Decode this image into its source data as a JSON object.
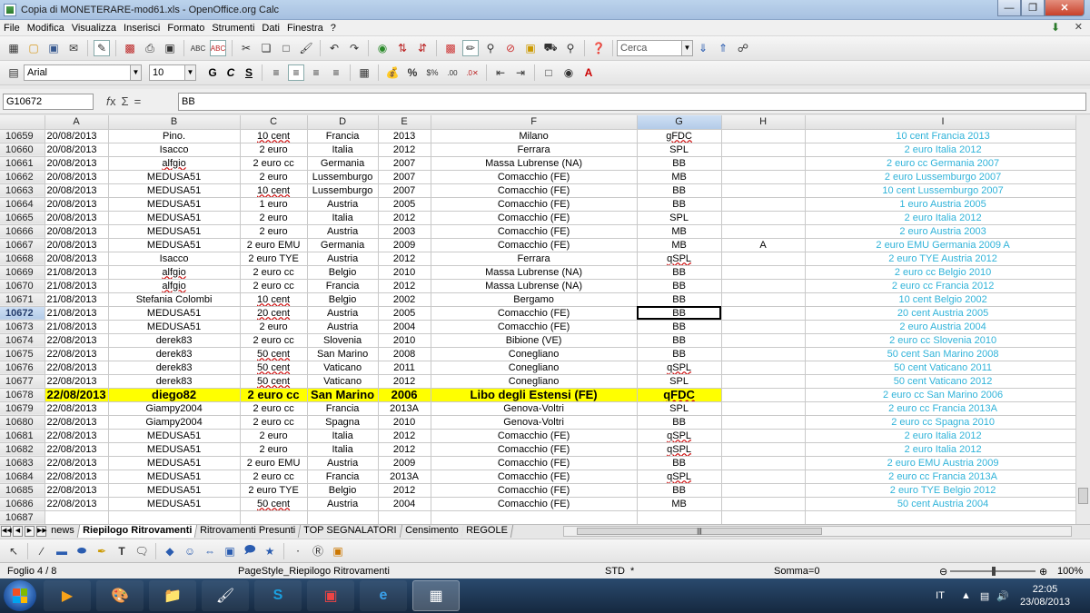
{
  "window": {
    "title": "Copia di MONETERARE-mod61.xls - OpenOffice.org Calc"
  },
  "menu": [
    "File",
    "Modifica",
    "Visualizza",
    "Inserisci",
    "Formato",
    "Strumenti",
    "Dati",
    "Finestra",
    "?"
  ],
  "toolbar": {
    "search_placeholder": "Cerca"
  },
  "format": {
    "font": "Arial",
    "size": "10",
    "bold": "G",
    "italic": "C",
    "underline": "S"
  },
  "formula": {
    "cell_ref": "G10672",
    "content": "BB"
  },
  "columns": [
    "A",
    "B",
    "C",
    "D",
    "E",
    "F",
    "G",
    "H",
    "I"
  ],
  "selected_column": "G",
  "selected_row": "10672",
  "highlight_row": "10678",
  "rows": [
    {
      "n": "10659",
      "a": "20/08/2013",
      "b": "Pino.",
      "c": "10 cent",
      "d": "Francia",
      "e": "2013",
      "f": "Milano",
      "g": "gFDC",
      "h": "",
      "i": "10 cent Francia 2013"
    },
    {
      "n": "10660",
      "a": "20/08/2013",
      "b": "Isacco",
      "c": "2 euro",
      "d": "Italia",
      "e": "2012",
      "f": "Ferrara",
      "g": "SPL",
      "h": "",
      "i": "2 euro Italia 2012"
    },
    {
      "n": "10661",
      "a": "20/08/2013",
      "b": "alfgio",
      "c": "2 euro cc",
      "d": "Germania",
      "e": "2007",
      "f": "Massa Lubrense (NA)",
      "g": "BB",
      "h": "",
      "i": "2 euro cc Germania 2007"
    },
    {
      "n": "10662",
      "a": "20/08/2013",
      "b": "MEDUSA51",
      "c": "2 euro",
      "d": "Lussemburgo",
      "e": "2007",
      "f": "Comacchio (FE)",
      "g": "MB",
      "h": "",
      "i": "2 euro Lussemburgo 2007"
    },
    {
      "n": "10663",
      "a": "20/08/2013",
      "b": "MEDUSA51",
      "c": "10 cent",
      "d": "Lussemburgo",
      "e": "2007",
      "f": "Comacchio (FE)",
      "g": "BB",
      "h": "",
      "i": "10 cent Lussemburgo 2007"
    },
    {
      "n": "10664",
      "a": "20/08/2013",
      "b": "MEDUSA51",
      "c": "1 euro",
      "d": "Austria",
      "e": "2005",
      "f": "Comacchio (FE)",
      "g": "BB",
      "h": "",
      "i": "1 euro Austria 2005"
    },
    {
      "n": "10665",
      "a": "20/08/2013",
      "b": "MEDUSA51",
      "c": "2 euro",
      "d": "Italia",
      "e": "2012",
      "f": "Comacchio (FE)",
      "g": "SPL",
      "h": "",
      "i": "2 euro Italia 2012"
    },
    {
      "n": "10666",
      "a": "20/08/2013",
      "b": "MEDUSA51",
      "c": "2 euro",
      "d": "Austria",
      "e": "2003",
      "f": "Comacchio (FE)",
      "g": "MB",
      "h": "",
      "i": "2 euro Austria 2003"
    },
    {
      "n": "10667",
      "a": "20/08/2013",
      "b": "MEDUSA51",
      "c": "2 euro EMU",
      "d": "Germania",
      "e": "2009",
      "f": "Comacchio (FE)",
      "g": "MB",
      "h": "A",
      "i": "2 euro EMU Germania 2009 A"
    },
    {
      "n": "10668",
      "a": "20/08/2013",
      "b": "Isacco",
      "c": "2 euro TYE",
      "d": "Austria",
      "e": "2012",
      "f": "Ferrara",
      "g": "qSPL",
      "h": "",
      "i": "2 euro TYE Austria 2012"
    },
    {
      "n": "10669",
      "a": "21/08/2013",
      "b": "alfgio",
      "c": "2 euro cc",
      "d": "Belgio",
      "e": "2010",
      "f": "Massa Lubrense (NA)",
      "g": "BB",
      "h": "",
      "i": "2 euro cc Belgio 2010"
    },
    {
      "n": "10670",
      "a": "21/08/2013",
      "b": "alfgio",
      "c": "2 euro cc",
      "d": "Francia",
      "e": "2012",
      "f": "Massa Lubrense (NA)",
      "g": "BB",
      "h": "",
      "i": "2 euro cc Francia 2012"
    },
    {
      "n": "10671",
      "a": "21/08/2013",
      "b": "Stefania Colombi",
      "c": "10 cent",
      "d": "Belgio",
      "e": "2002",
      "f": "Bergamo",
      "g": "BB",
      "h": "",
      "i": "10 cent Belgio 2002"
    },
    {
      "n": "10672",
      "a": "21/08/2013",
      "b": "MEDUSA51",
      "c": "20 cent",
      "d": "Austria",
      "e": "2005",
      "f": "Comacchio (FE)",
      "g": "BB",
      "h": "",
      "i": "20 cent Austria 2005"
    },
    {
      "n": "10673",
      "a": "21/08/2013",
      "b": "MEDUSA51",
      "c": "2 euro",
      "d": "Austria",
      "e": "2004",
      "f": "Comacchio (FE)",
      "g": "BB",
      "h": "",
      "i": "2 euro Austria 2004"
    },
    {
      "n": "10674",
      "a": "22/08/2013",
      "b": "derek83",
      "c": "2 euro cc",
      "d": "Slovenia",
      "e": "2010",
      "f": "Bibione (VE)",
      "g": "BB",
      "h": "",
      "i": "2 euro cc Slovenia 2010"
    },
    {
      "n": "10675",
      "a": "22/08/2013",
      "b": "derek83",
      "c": "50 cent",
      "d": "San Marino",
      "e": "2008",
      "f": "Conegliano",
      "g": "BB",
      "h": "",
      "i": "50 cent San Marino 2008"
    },
    {
      "n": "10676",
      "a": "22/08/2013",
      "b": "derek83",
      "c": "50 cent",
      "d": "Vaticano",
      "e": "2011",
      "f": "Conegliano",
      "g": "qSPL",
      "h": "",
      "i": "50 cent Vaticano 2011"
    },
    {
      "n": "10677",
      "a": "22/08/2013",
      "b": "derek83",
      "c": "50 cent",
      "d": "Vaticano",
      "e": "2012",
      "f": "Conegliano",
      "g": "SPL",
      "h": "",
      "i": "50 cent Vaticano 2012"
    },
    {
      "n": "10678",
      "a": "22/08/2013",
      "b": "diego82",
      "c": "2 euro cc",
      "d": "San Marino",
      "e": "2006",
      "f": "Libo degli Estensi (FE)",
      "g": "qFDC",
      "h": "",
      "i": "2 euro cc San Marino 2006"
    },
    {
      "n": "10679",
      "a": "22/08/2013",
      "b": "Giampy2004",
      "c": "2 euro cc",
      "d": "Francia",
      "e": "2013A",
      "f": "Genova-Voltri",
      "g": "SPL",
      "h": "",
      "i": "2 euro cc Francia 2013A"
    },
    {
      "n": "10680",
      "a": "22/08/2013",
      "b": "Giampy2004",
      "c": "2 euro cc",
      "d": "Spagna",
      "e": "2010",
      "f": "Genova-Voltri",
      "g": "BB",
      "h": "",
      "i": "2 euro cc Spagna 2010"
    },
    {
      "n": "10681",
      "a": "22/08/2013",
      "b": "MEDUSA51",
      "c": "2 euro",
      "d": "Italia",
      "e": "2012",
      "f": "Comacchio (FE)",
      "g": "qSPL",
      "h": "",
      "i": "2 euro  Italia 2012"
    },
    {
      "n": "10682",
      "a": "22/08/2013",
      "b": "MEDUSA51",
      "c": "2 euro",
      "d": "Italia",
      "e": "2012",
      "f": "Comacchio (FE)",
      "g": "qSPL",
      "h": "",
      "i": "2 euro  Italia 2012"
    },
    {
      "n": "10683",
      "a": "22/08/2013",
      "b": "MEDUSA51",
      "c": "2 euro EMU",
      "d": "Austria",
      "e": "2009",
      "f": "Comacchio (FE)",
      "g": "BB",
      "h": "",
      "i": "2 euro EMU Austria 2009"
    },
    {
      "n": "10684",
      "a": "22/08/2013",
      "b": "MEDUSA51",
      "c": "2 euro cc",
      "d": "Francia",
      "e": "2013A",
      "f": "Comacchio (FE)",
      "g": "qSPL",
      "h": "",
      "i": "2 euro cc Francia 2013A"
    },
    {
      "n": "10685",
      "a": "22/08/2013",
      "b": "MEDUSA51",
      "c": "2 euro TYE",
      "d": "Belgio",
      "e": "2012",
      "f": "Comacchio (FE)",
      "g": "BB",
      "h": "",
      "i": "2 euro TYE Belgio 2012"
    },
    {
      "n": "10686",
      "a": "22/08/2013",
      "b": "MEDUSA51",
      "c": "50 cent",
      "d": "Austria",
      "e": "2004",
      "f": "Comacchio (FE)",
      "g": "MB",
      "h": "",
      "i": "50 cent Austria 2004"
    },
    {
      "n": "10687",
      "a": "",
      "b": "",
      "c": "",
      "d": "",
      "e": "",
      "f": "",
      "g": "",
      "h": "",
      "i": ""
    }
  ],
  "sheet_tabs": [
    "news",
    "Riepilogo Ritrovamenti",
    "Ritrovamenti Presunti",
    "TOP SEGNALATORI",
    "Censimento",
    "REGOLE"
  ],
  "active_tab": "Riepilogo Ritrovamenti",
  "status": {
    "sheet": "Foglio 4 / 8",
    "page_style": "PageStyle_Riepilogo Ritrovamenti",
    "mode": "STD",
    "star": "*",
    "sum": "Somma=0",
    "zoom": "100%"
  },
  "taskbar": {
    "lang": "IT",
    "time": "22:05",
    "date": "23/08/2013"
  }
}
